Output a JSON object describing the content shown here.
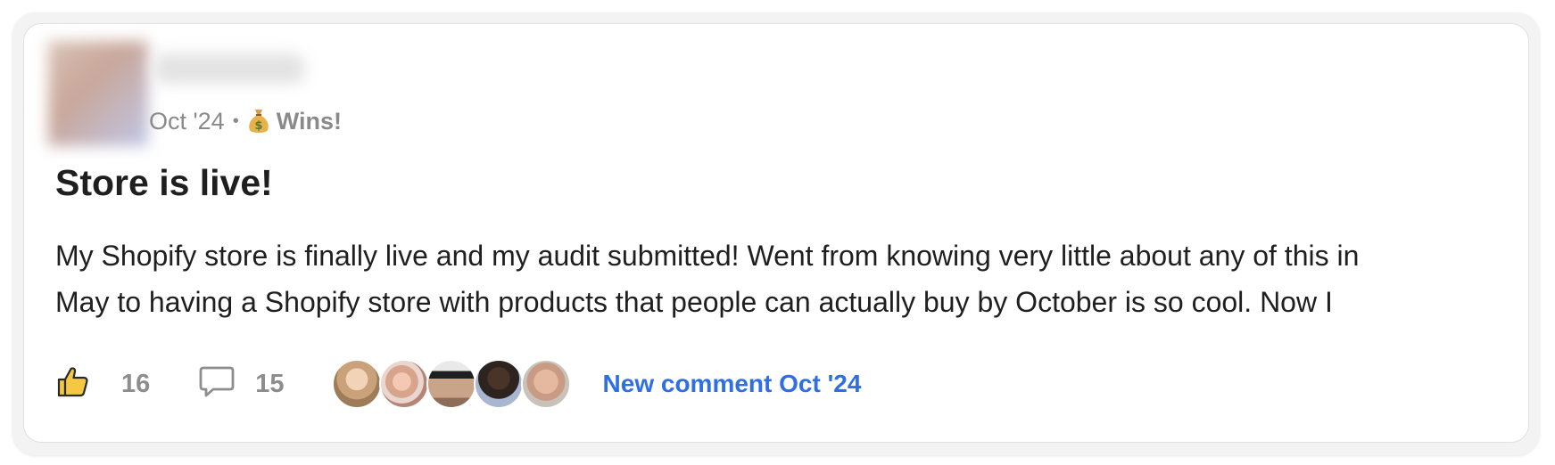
{
  "post": {
    "author": {
      "name": "",
      "avatar_icon": "user-avatar-blurred"
    },
    "date": "Oct '24",
    "separator": "•",
    "category": {
      "emoji_icon": "money-bag-icon",
      "label": "Wins!"
    },
    "title": "Store is live!",
    "body_lines": [
      "My Shopify store is finally live and my audit submitted! Went from knowing very little about any of this in",
      "May to having a Shopify store with products that people can actually buy by October is so cool. Now I"
    ],
    "likes": {
      "icon": "thumbs-up-icon",
      "count": "16"
    },
    "comments": {
      "icon": "comment-bubble-icon",
      "count": "15"
    },
    "commenter_avatars": 5,
    "new_comment": "New comment Oct '24"
  },
  "colors": {
    "accent_link": "#2f6fe3",
    "muted_text": "#8a8a8a",
    "title_text": "#1f1f1f",
    "like_icon_fill": "#f5c843"
  }
}
